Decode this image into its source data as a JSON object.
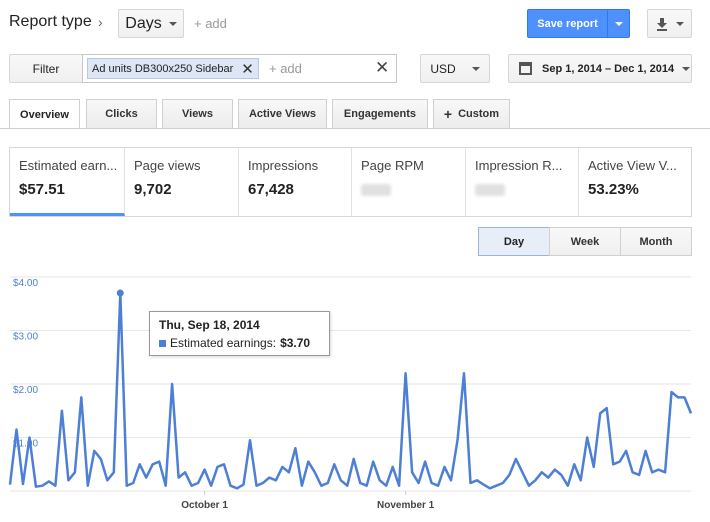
{
  "header": {
    "report_type": "Report type",
    "granularity_dropdown": "Days",
    "add_label": "+ add",
    "save_report": "Save report"
  },
  "filters": {
    "filter_button": "Filter",
    "chip_prefix": "Ad units",
    "chip_value": "DB300x250 Sidebar",
    "add_label": "+ add",
    "currency": "USD",
    "date_range": "Sep 1, 2014 – Dec 1, 2014"
  },
  "tabs": [
    "Overview",
    "Clicks",
    "Views",
    "Active Views",
    "Engagements",
    "Custom"
  ],
  "scorecards": [
    {
      "title": "Estimated earn...",
      "value": "$57.51"
    },
    {
      "title": "Page views",
      "value": "9,702"
    },
    {
      "title": "Impressions",
      "value": "67,428"
    },
    {
      "title": "Page RPM",
      "value": ""
    },
    {
      "title": "Impression R...",
      "value": ""
    },
    {
      "title": "Active View V...",
      "value": "53.23%"
    }
  ],
  "granularity_buttons": [
    "Day",
    "Week",
    "Month"
  ],
  "tooltip": {
    "date": "Thu, Sep 18, 2014",
    "series": "Estimated earnings:",
    "value": "$3.70"
  },
  "colors": {
    "accent": "#4d90fe",
    "series": "#4d7fd6"
  },
  "chart_data": {
    "type": "line",
    "title": "",
    "xlabel": "",
    "ylabel": "",
    "ylim": [
      0,
      4
    ],
    "yticks": [
      "$1.00",
      "$2.00",
      "$3.00",
      "$4.00"
    ],
    "xticks": [
      {
        "label": "October 1",
        "day": 30
      },
      {
        "label": "November 1",
        "day": 61
      }
    ],
    "x_start": "Sep 1, 2014",
    "series": [
      {
        "name": "Estimated earnings",
        "values": [
          0.12,
          1.15,
          0.13,
          1.0,
          0.08,
          0.1,
          0.18,
          0.1,
          1.5,
          0.2,
          0.35,
          1.75,
          0.1,
          0.75,
          0.6,
          0.2,
          0.35,
          3.7,
          0.1,
          0.15,
          0.5,
          0.25,
          0.5,
          0.55,
          0.1,
          2.0,
          0.25,
          0.35,
          0.1,
          0.15,
          0.4,
          0.1,
          0.45,
          0.5,
          0.1,
          0.05,
          0.12,
          0.95,
          0.1,
          0.15,
          0.25,
          0.2,
          0.45,
          0.35,
          0.8,
          0.1,
          0.55,
          0.35,
          0.1,
          0.15,
          0.5,
          0.2,
          0.1,
          0.6,
          0.15,
          0.1,
          0.55,
          0.2,
          0.1,
          0.45,
          0.1,
          2.2,
          0.35,
          0.15,
          0.55,
          0.15,
          0.1,
          0.45,
          0.2,
          0.95,
          2.2,
          0.15,
          0.2,
          0.12,
          0.05,
          0.1,
          0.15,
          0.3,
          0.6,
          0.35,
          0.1,
          0.2,
          0.35,
          0.25,
          0.4,
          0.3,
          0.1,
          0.5,
          0.2,
          1.0,
          0.45,
          1.45,
          1.55,
          0.5,
          0.55,
          0.75,
          0.35,
          0.3,
          0.75,
          0.35,
          0.4,
          0.35,
          1.85,
          1.75,
          1.75,
          1.45
        ]
      }
    ],
    "highlight": {
      "index": 17,
      "date": "Thu, Sep 18, 2014",
      "value": 3.7
    }
  }
}
